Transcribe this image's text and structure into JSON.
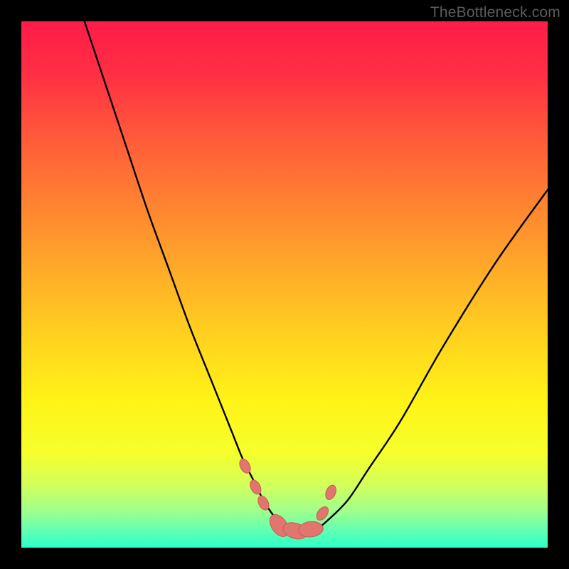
{
  "watermark": "TheBottleneck.com",
  "gradient_stops": [
    {
      "offset": 0.0,
      "color": "#ff1c49"
    },
    {
      "offset": 0.1,
      "color": "#ff2f44"
    },
    {
      "offset": 0.22,
      "color": "#ff5a3a"
    },
    {
      "offset": 0.35,
      "color": "#ff8431"
    },
    {
      "offset": 0.48,
      "color": "#ffad28"
    },
    {
      "offset": 0.6,
      "color": "#ffd21f"
    },
    {
      "offset": 0.72,
      "color": "#fff317"
    },
    {
      "offset": 0.82,
      "color": "#f6ff2c"
    },
    {
      "offset": 0.88,
      "color": "#d4ff5a"
    },
    {
      "offset": 0.93,
      "color": "#a0ff8c"
    },
    {
      "offset": 0.965,
      "color": "#66ffb0"
    },
    {
      "offset": 1.0,
      "color": "#2bffc8"
    }
  ],
  "curve_color": "#000000",
  "marker_fill": "#e0766e",
  "marker_stroke": "#cf5a52",
  "chart_data": {
    "type": "line",
    "title": "",
    "xlabel": "",
    "ylabel": "",
    "xlim": [
      0,
      100
    ],
    "ylim": [
      0,
      100
    ],
    "grid": false,
    "legend": false,
    "series": [
      {
        "name": "bottleneck-curve",
        "x": [
          12,
          16,
          20,
          24,
          28,
          32,
          36,
          40,
          42,
          44,
          46,
          48,
          50,
          52,
          54,
          56,
          58,
          62,
          66,
          72,
          80,
          90,
          100
        ],
        "y": [
          100,
          88,
          76,
          64,
          53,
          42,
          32,
          22,
          17,
          13,
          9,
          6,
          4,
          3,
          3,
          3.5,
          5,
          9,
          15,
          24,
          38,
          54,
          68
        ]
      }
    ],
    "markers": {
      "name": "highlighted-points",
      "x": [
        42.5,
        44.5,
        46.0,
        49.0,
        52.0,
        55.0,
        57.2,
        58.8
      ],
      "y": [
        15.5,
        11.5,
        8.5,
        4.2,
        3.2,
        3.5,
        6.5,
        10.5
      ],
      "size": [
        1.6,
        1.6,
        1.6,
        2.6,
        2.6,
        2.6,
        1.6,
        1.6
      ]
    }
  }
}
